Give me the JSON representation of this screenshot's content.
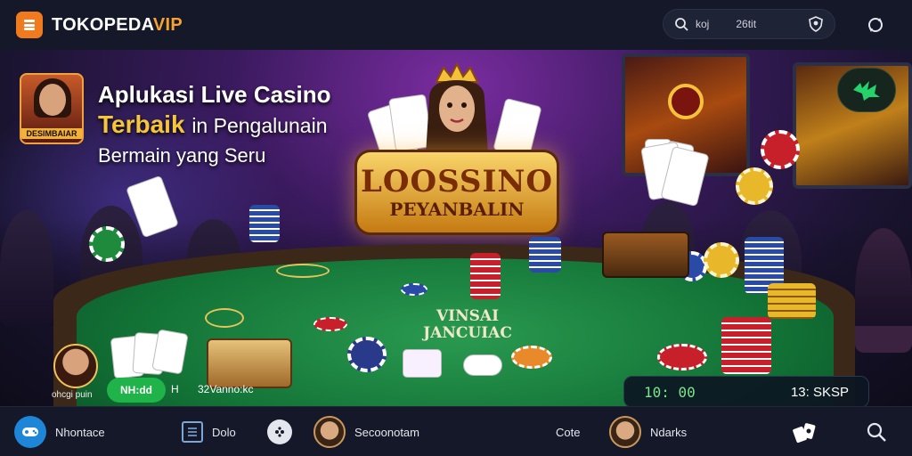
{
  "brand": {
    "name": "TOKOPEDA",
    "name_accent": "VIP"
  },
  "search": {
    "query": "koj",
    "count": "26tit"
  },
  "hero": {
    "avatar_label": "DESIMBAIAR",
    "headline_line1": "Aplukasi Live Casino",
    "headline_line2_bold": "Terbaik",
    "headline_line2_rest": "in Pengalunain",
    "headline_line3": "Bermain yang Seru",
    "badge_title": "LOOSSINO",
    "badge_sub": "PEYANBALIN",
    "felt_line1": "VINSAI",
    "felt_line2": "JANCUIAC",
    "player_label": "ohcgi puin",
    "pill_label": "NH:dd",
    "pill_h": "H",
    "pill_text": "32Vanno:kc",
    "timer_left": "10: 00",
    "timer_right": "13: SKSP"
  },
  "nav": {
    "items": [
      {
        "label": "Nhontace",
        "icon": "game-controller-icon"
      },
      {
        "label": "Dolo",
        "icon": "list-icon"
      },
      {
        "label": "",
        "icon": "dots-icon"
      },
      {
        "label": "Secoonotam",
        "icon": "avatar"
      },
      {
        "label": "Cote",
        "icon": ""
      },
      {
        "label": "Ndarks",
        "icon": "avatar"
      },
      {
        "label": "",
        "icon": "cards-icon"
      },
      {
        "label": "",
        "icon": "search-icon"
      }
    ]
  },
  "colors": {
    "accent": "#f7a12f",
    "brand_logo": "#f07a1e",
    "felt": "#127236",
    "pill": "#1fb349"
  }
}
